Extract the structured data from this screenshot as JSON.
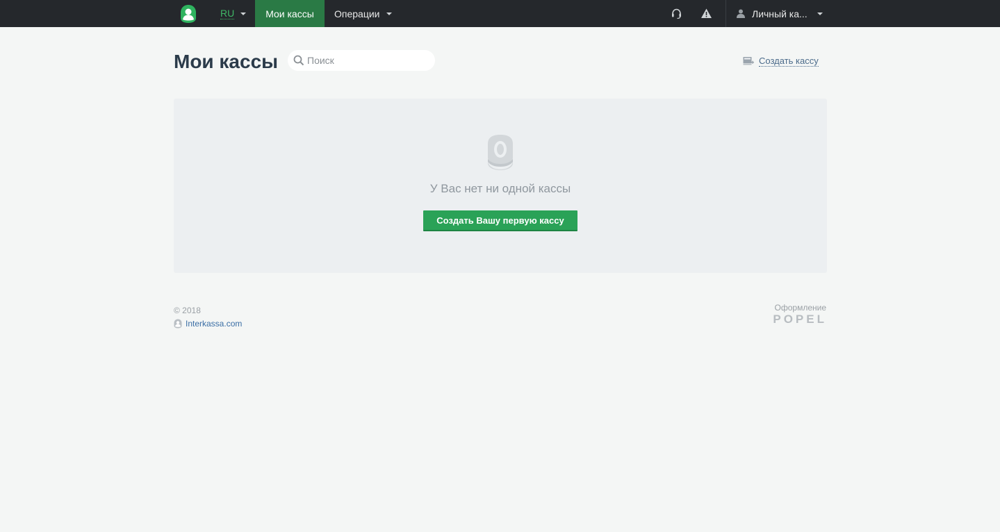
{
  "navbar": {
    "language": "RU",
    "nav_items": [
      {
        "label": "Мои кассы",
        "active": true
      },
      {
        "label": "Операции",
        "active": false
      }
    ],
    "account_label": "Личный ка...",
    "icons": [
      "headset-icon",
      "warning-icon",
      "user-icon",
      "chevron-down-icon"
    ],
    "colors": {
      "bar": "#25282c",
      "active_tab": "#2a7a45",
      "language": "#3fb866"
    }
  },
  "header": {
    "title": "Мои кассы",
    "search_placeholder": "Поиск",
    "create_label": "Создать кассу"
  },
  "empty_state": {
    "message": "У Вас нет ни одной кассы",
    "button_label": "Создать Вашу первую кассу",
    "icon": "coin-zero-icon",
    "colors": {
      "button": "#2aa257"
    }
  },
  "footer": {
    "copyright": "© 2018",
    "site_label": "Interkassa.com",
    "design_label": "Оформление",
    "design_brand": "POPEL"
  }
}
